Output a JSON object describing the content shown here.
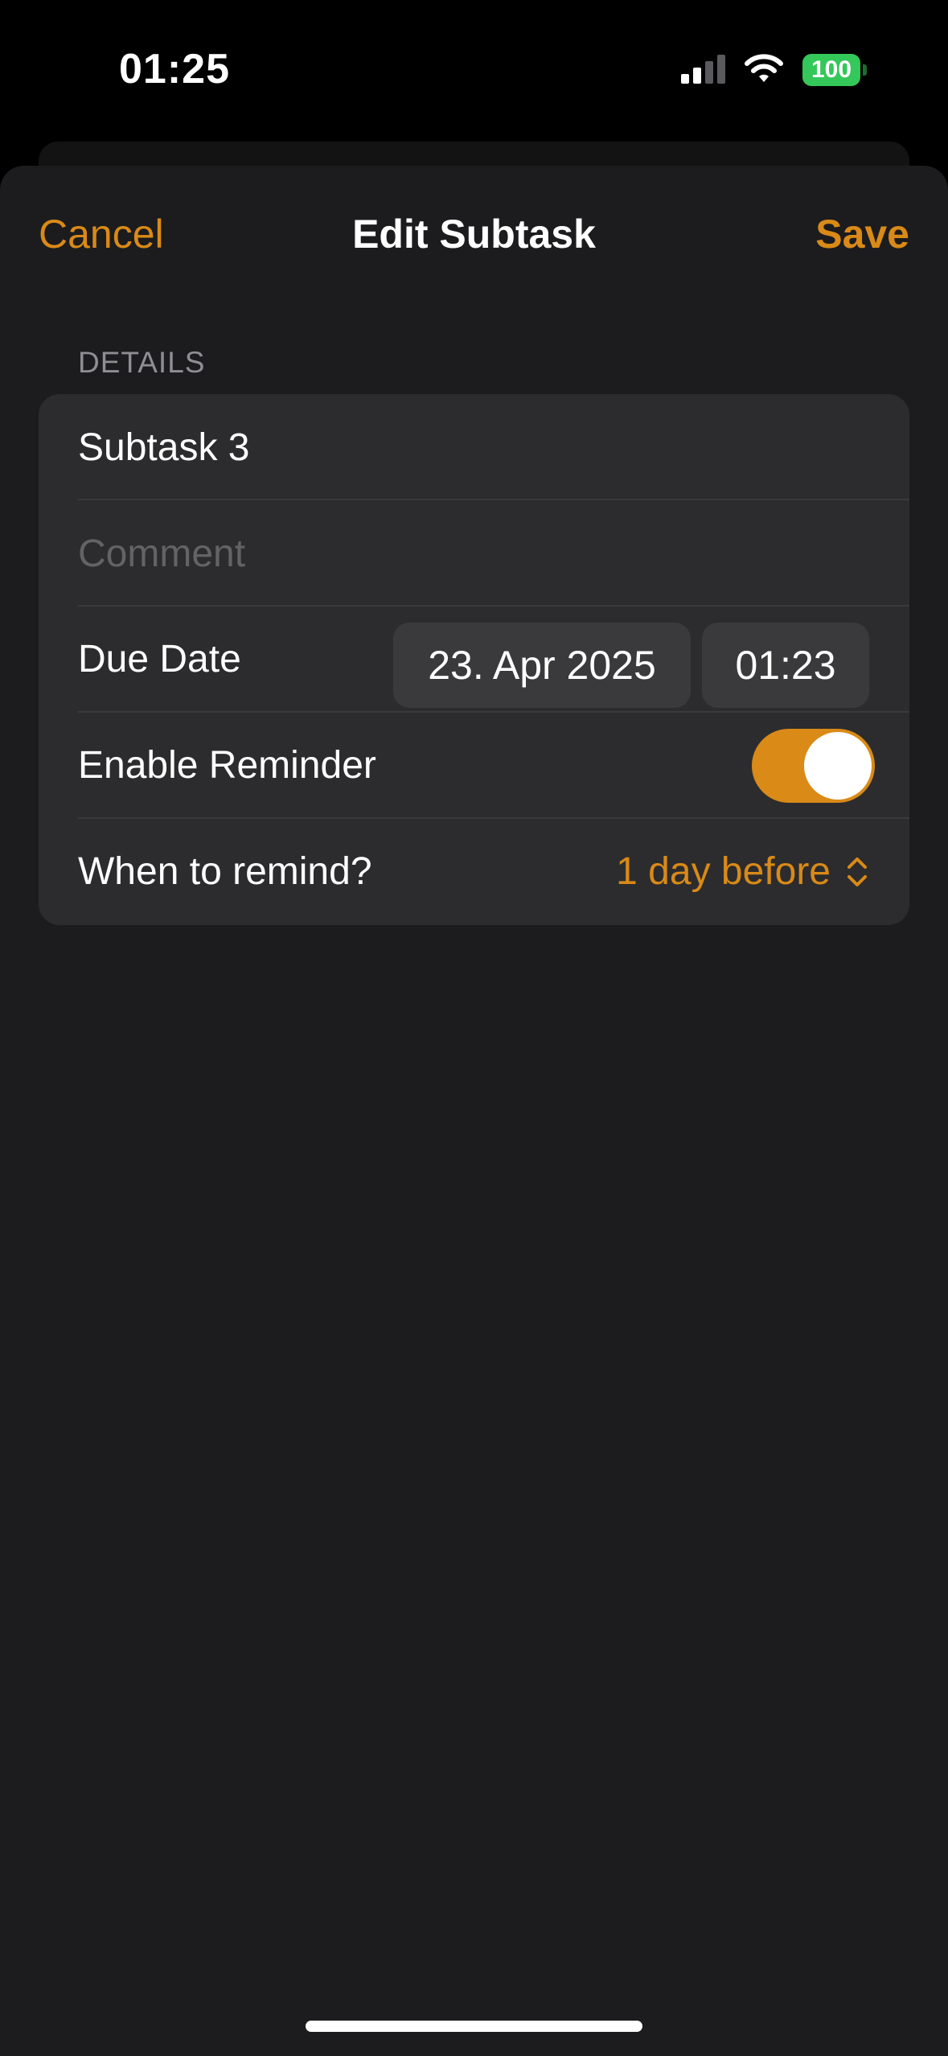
{
  "status_bar": {
    "time": "01:25",
    "battery": "100"
  },
  "nav": {
    "cancel_label": "Cancel",
    "title": "Edit Subtask",
    "save_label": "Save"
  },
  "details": {
    "header": "DETAILS",
    "name_value": "Subtask 3",
    "comment_placeholder": "Comment",
    "due_date_label": "Due Date",
    "due_date_value": "23. Apr 2025",
    "due_time_value": "01:23",
    "reminder_label": "Enable Reminder",
    "reminder_enabled": true,
    "remind_when_label": "When to remind?",
    "remind_when_value": "1 day before"
  },
  "icons": {
    "signal": "signal-icon",
    "wifi": "wifi-icon",
    "battery": "battery-icon",
    "remind_picker": "chevron-updown-icon"
  },
  "colors": {
    "accent": "#d98a17",
    "sheet_background": "#1c1c1e",
    "group_background": "#2c2c2e",
    "battery": "#34c759"
  }
}
